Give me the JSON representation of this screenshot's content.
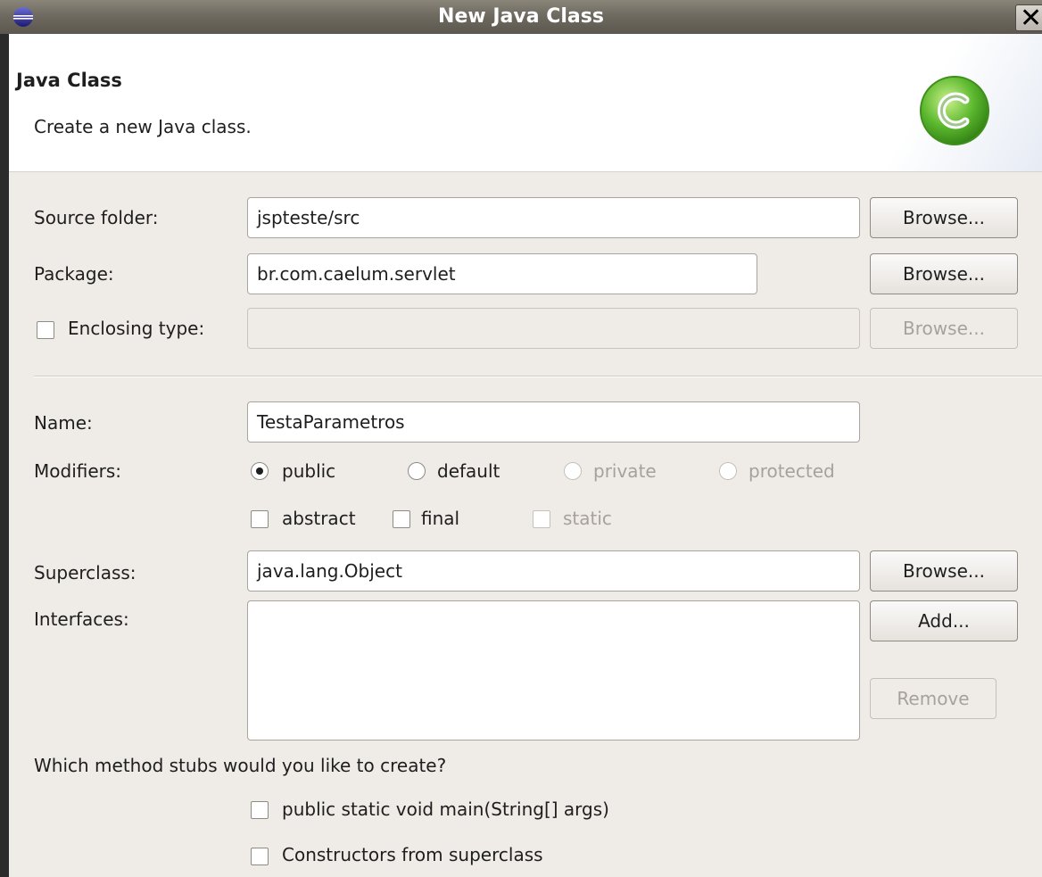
{
  "window": {
    "title": "New Java Class",
    "close_label": "✕"
  },
  "header": {
    "heading": "Java Class",
    "description": "Create a new Java class."
  },
  "form": {
    "source_folder": {
      "label": "Source folder:",
      "value": "jspteste/src",
      "button": "Browse..."
    },
    "package": {
      "label": "Package:",
      "value": "br.com.caelum.servlet",
      "button": "Browse..."
    },
    "enclosing_type": {
      "label": "Enclosing type:",
      "value": "",
      "button": "Browse...",
      "checked": false
    },
    "name": {
      "label": "Name:",
      "value": "TestaParametros"
    },
    "modifiers": {
      "label": "Modifiers:",
      "access": [
        {
          "label": "public",
          "selected": true,
          "enabled": true
        },
        {
          "label": "default",
          "selected": false,
          "enabled": true
        },
        {
          "label": "private",
          "selected": false,
          "enabled": false
        },
        {
          "label": "protected",
          "selected": false,
          "enabled": false
        }
      ],
      "flags": [
        {
          "label": "abstract",
          "checked": false,
          "enabled": true
        },
        {
          "label": "final",
          "checked": false,
          "enabled": true
        },
        {
          "label": "static",
          "checked": false,
          "enabled": false
        }
      ]
    },
    "superclass": {
      "label": "Superclass:",
      "value": "java.lang.Object",
      "button": "Browse..."
    },
    "interfaces": {
      "label": "Interfaces:",
      "add_button": "Add...",
      "remove_button": "Remove",
      "items": []
    },
    "method_stubs": {
      "question": "Which method stubs would you like to create?",
      "options": [
        {
          "label": "public static void main(String[] args)",
          "checked": false
        },
        {
          "label": "Constructors from superclass",
          "checked": false
        }
      ]
    }
  },
  "colors": {
    "title_bar": "#6f6a60",
    "dialog_bg": "#efebe7",
    "header_bg": "#ffffff",
    "class_icon": "#5cb82e"
  },
  "icons": {
    "app": "eclipse-icon",
    "class": "java-class-c-icon",
    "close": "close-icon"
  }
}
